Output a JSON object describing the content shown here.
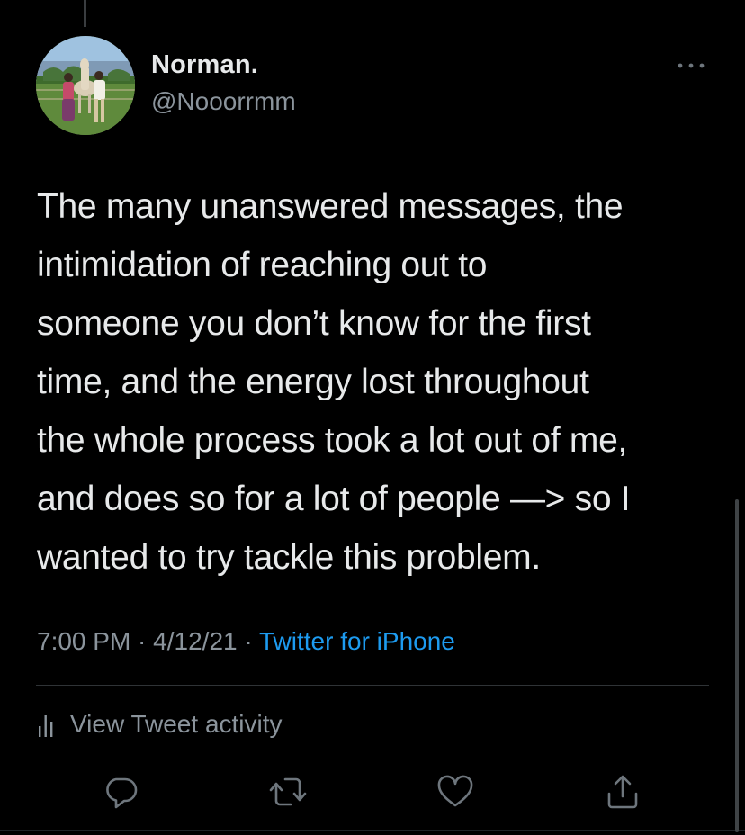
{
  "author": {
    "name": "Norman.",
    "handle": "@Nooorrmm"
  },
  "tweet": {
    "text": "The many unanswered messages, the\nintimidation of reaching out to\nsomeone you don’t know for the first\ntime, and the energy lost throughout\nthe whole process took a lot out of me,\nand does so for a lot of people —> so I\nwanted to try tackle this problem.",
    "time": "7:00 PM",
    "date": "4/12/21",
    "separator": " · ",
    "source": "Twitter for iPhone"
  },
  "activity": {
    "label": "View Tweet activity"
  },
  "actions": [
    {
      "icon": "reply-icon"
    },
    {
      "icon": "retweet-icon"
    },
    {
      "icon": "like-icon"
    },
    {
      "icon": "share-icon"
    }
  ],
  "colors": {
    "background": "#000000",
    "primary_text": "#e7e9ea",
    "secondary_text": "#8b949c",
    "link": "#1d9bf0",
    "divider": "#2f3336"
  }
}
